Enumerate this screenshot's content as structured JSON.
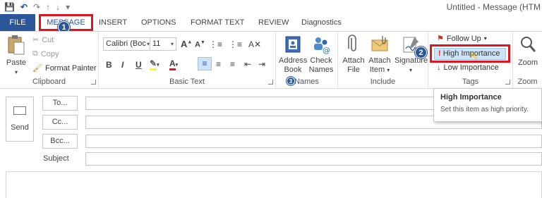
{
  "window": {
    "title": "Untitled - Message (HTM"
  },
  "tabs": {
    "file": "FILE",
    "items": [
      "MESSAGE",
      "INSERT",
      "OPTIONS",
      "FORMAT TEXT",
      "REVIEW",
      "Diagnostics"
    ]
  },
  "ribbon": {
    "clipboard": {
      "label": "Clipboard",
      "paste": "Paste",
      "cut": "Cut",
      "copy": "Copy",
      "format_painter": "Format Painter"
    },
    "basic_text": {
      "label": "Basic Text",
      "font": "Calibri (Boc",
      "size": "11",
      "bold": "B",
      "italic": "I",
      "underline": "U"
    },
    "names": {
      "label": "Names",
      "address_book_1": "Address",
      "address_book_2": "Book",
      "check_names_1": "Check",
      "check_names_2": "Names"
    },
    "include": {
      "label": "Include",
      "attach_file_1": "Attach",
      "attach_file_2": "File",
      "attach_item_1": "Attach",
      "attach_item_2": "Item",
      "signature": "Signature"
    },
    "tags": {
      "label": "Tags",
      "follow_up": "Follow Up",
      "high_importance": "High Importance",
      "low_importance": "Low Importance"
    },
    "zoom": {
      "label": "Zoom",
      "zoom": "Zoom"
    }
  },
  "callouts": {
    "one": "1",
    "two": "2",
    "three": "3"
  },
  "tooltip": {
    "title": "High Importance",
    "text": "Set this item as high priority."
  },
  "compose": {
    "send": "Send",
    "to": "To...",
    "cc": "Cc...",
    "bcc": "Bcc...",
    "subject": "Subject"
  },
  "colors": {
    "accent": "#2b579a",
    "highlight": "#e0141e",
    "font_color": "#e0141e",
    "highlight_color": "#ffff00"
  }
}
